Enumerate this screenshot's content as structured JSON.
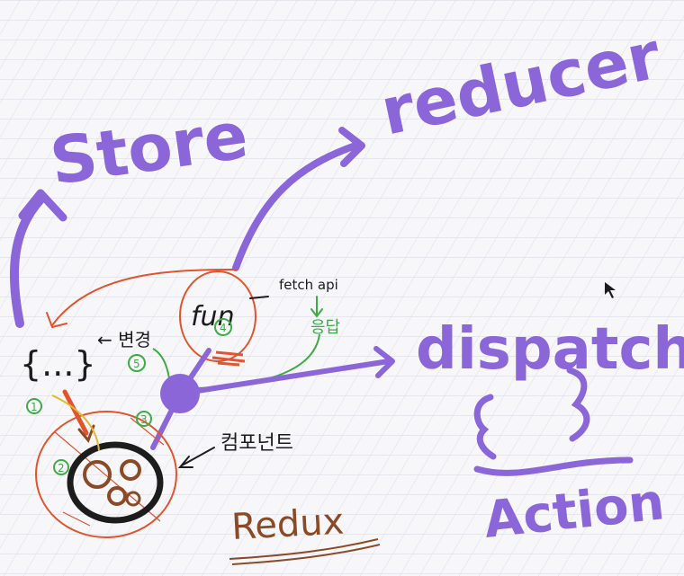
{
  "labels": {
    "store": "Store",
    "reducer": "reducer",
    "dispatch": "dispatch",
    "action": "Action",
    "redux": "Redux",
    "state_braces": "{...}",
    "change_korean": "← 변경",
    "fun": "fun",
    "fetch_api": "fetch api",
    "response_korean": "응답",
    "component_korean": "컴포넌트",
    "step_1": "1",
    "step_2": "2",
    "step_3": "3",
    "step_4": "4",
    "step_5": "5"
  },
  "colors": {
    "purple": "#8a66d8",
    "red": "#e0542e",
    "green": "#3faa48",
    "brown": "#8b4a26",
    "black": "#1c1c1c",
    "grid": "#d9d9e3",
    "background": "#f7f7fa"
  }
}
